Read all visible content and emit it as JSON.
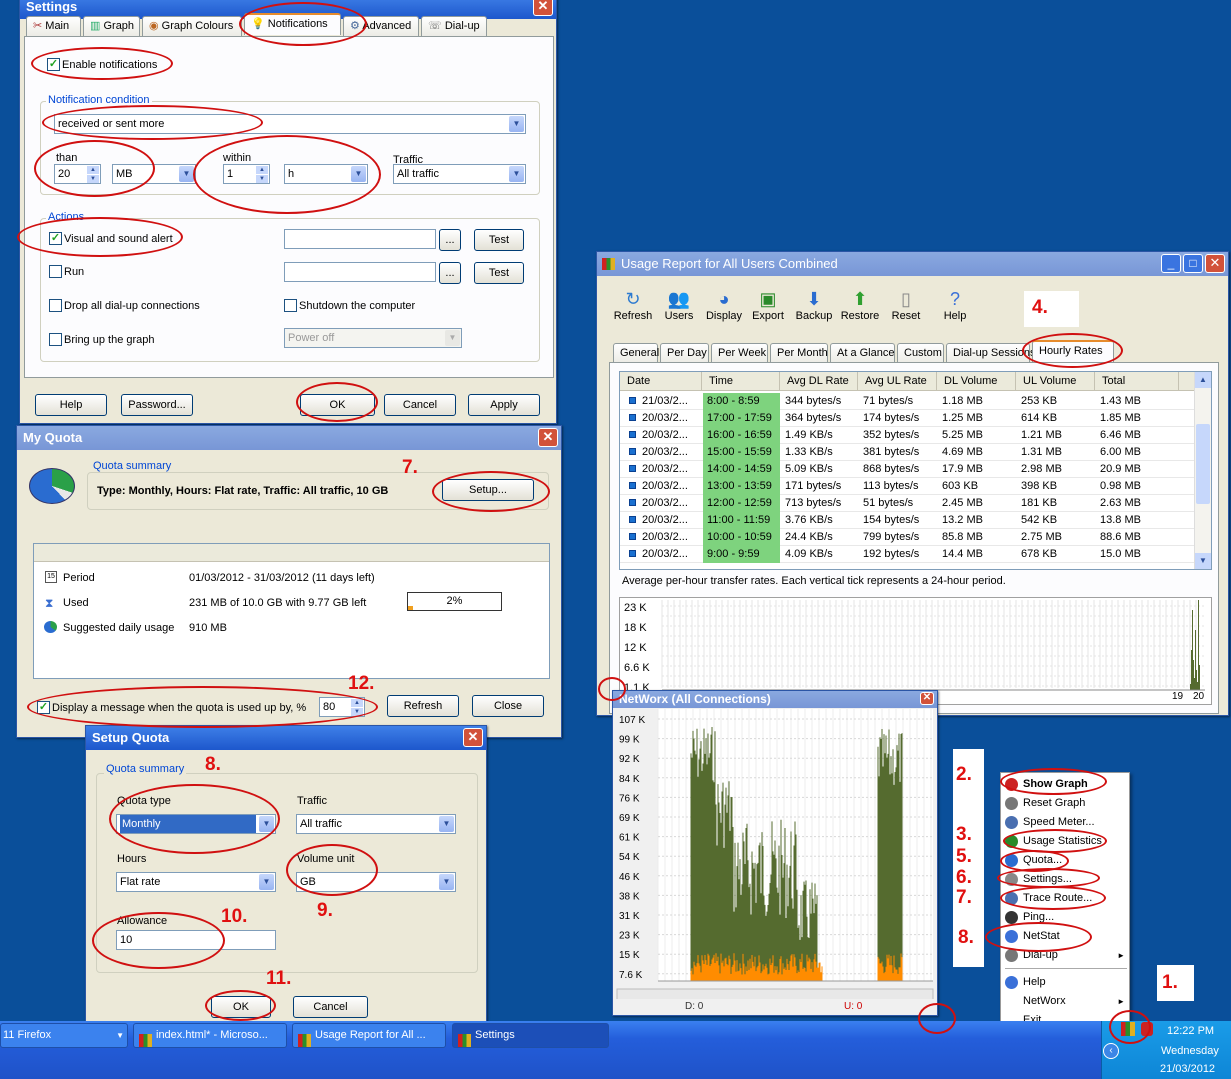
{
  "settings": {
    "title": "Settings",
    "tabs": [
      "Main",
      "Graph",
      "Graph Colours",
      "Notifications",
      "Advanced",
      "Dial-up"
    ],
    "enable_notifications": "Enable notifications",
    "condition_group": "Notification condition",
    "condition_value": "received or sent more",
    "than_label": "than",
    "than_value": "20",
    "than_unit": "MB",
    "within_label": "within",
    "within_value": "1",
    "within_unit": "h",
    "traffic_label": "Traffic",
    "traffic_value": "All traffic",
    "actions_group": "Actions",
    "visual_alert": "Visual and sound alert",
    "run": "Run",
    "drop_dialup": "Drop all dial-up connections",
    "shutdown": "Shutdown the computer",
    "bring_graph": "Bring up the graph",
    "power_value": "Power off",
    "browse": "...",
    "test": "Test",
    "help": "Help",
    "password": "Password...",
    "ok": "OK",
    "cancel": "Cancel",
    "apply": "Apply"
  },
  "quota": {
    "title": "My Quota",
    "summary_group": "Quota summary",
    "summary_text": "Type: Monthly, Hours: Flat rate, Traffic: All traffic, 10 GB",
    "setup": "Setup...",
    "rows": [
      {
        "label": "Period",
        "value": "01/03/2012 - 31/03/2012 (11 days left)"
      },
      {
        "label": "Used",
        "value": "231 MB of 10.0 GB with 9.77 GB left"
      },
      {
        "label": "Suggested daily usage",
        "value": "910 MB"
      }
    ],
    "progress_text": "2%",
    "progress_fraction": 0.02,
    "display_msg": "Display a message when the quota is used up by, %",
    "display_value": "80",
    "refresh": "Refresh",
    "close": "Close"
  },
  "setup": {
    "title": "Setup Quota",
    "summary_group": "Quota summary",
    "type_label": "Quota type",
    "type_value": "Monthly",
    "traffic_label": "Traffic",
    "traffic_value": "All traffic",
    "hours_label": "Hours",
    "hours_value": "Flat rate",
    "unit_label": "Volume unit",
    "unit_value": "GB",
    "allowance_label": "Allowance",
    "allowance_value": "10",
    "ok": "OK",
    "cancel": "Cancel"
  },
  "usage": {
    "title": "Usage Report for All Users Combined",
    "toolbar": [
      "Refresh",
      "Users",
      "Display",
      "Export",
      "Backup",
      "Restore",
      "Reset",
      "Help"
    ],
    "tabs": [
      "General",
      "Per Day",
      "Per Week",
      "Per Month",
      "At a Glance",
      "Custom",
      "Dial-up Sessions",
      "Hourly Rates"
    ],
    "columns": [
      "Date",
      "Time",
      "Avg DL Rate",
      "Avg UL Rate",
      "DL Volume",
      "UL Volume",
      "Total"
    ],
    "rows": [
      [
        "21/03/2...",
        "8:00 - 8:59",
        "344 bytes/s",
        "71 bytes/s",
        "1.18 MB",
        "253 KB",
        "1.43 MB"
      ],
      [
        "20/03/2...",
        "17:00 - 17:59",
        "364 bytes/s",
        "174 bytes/s",
        "1.25 MB",
        "614 KB",
        "1.85 MB"
      ],
      [
        "20/03/2...",
        "16:00 - 16:59",
        "1.49 KB/s",
        "352 bytes/s",
        "5.25 MB",
        "1.21 MB",
        "6.46 MB"
      ],
      [
        "20/03/2...",
        "15:00 - 15:59",
        "1.33 KB/s",
        "381 bytes/s",
        "4.69 MB",
        "1.31 MB",
        "6.00 MB"
      ],
      [
        "20/03/2...",
        "14:00 - 14:59",
        "5.09 KB/s",
        "868 bytes/s",
        "17.9 MB",
        "2.98 MB",
        "20.9 MB"
      ],
      [
        "20/03/2...",
        "13:00 - 13:59",
        "171 bytes/s",
        "113 bytes/s",
        "603 KB",
        "398 KB",
        "0.98 MB"
      ],
      [
        "20/03/2...",
        "12:00 - 12:59",
        "713 bytes/s",
        "51 bytes/s",
        "2.45 MB",
        "181 KB",
        "2.63 MB"
      ],
      [
        "20/03/2...",
        "11:00 - 11:59",
        "3.76 KB/s",
        "154 bytes/s",
        "13.2 MB",
        "542 KB",
        "13.8 MB"
      ],
      [
        "20/03/2...",
        "10:00 - 10:59",
        "24.4 KB/s",
        "799 bytes/s",
        "85.8 MB",
        "2.75 MB",
        "88.6 MB"
      ],
      [
        "20/03/2...",
        "9:00 - 9:59",
        "4.09 KB/s",
        "192 bytes/s",
        "14.4 MB",
        "678 KB",
        "15.0 MB"
      ]
    ],
    "caption": "Average per-hour transfer rates. Each vertical tick represents a 24-hour period.",
    "chart_y": [
      "23 K",
      "18 K",
      "12 K",
      "6.6 K",
      "1.1 K"
    ],
    "chart_x": [
      "19",
      "20"
    ]
  },
  "networx": {
    "title": "NetWorx (All Connections)",
    "y_ticks": [
      "107 K",
      "99 K",
      "92 K",
      "84 K",
      "76 K",
      "69 K",
      "61 K",
      "54 K",
      "46 K",
      "38 K",
      "31 K",
      "23 K",
      "15 K",
      "7.6 K"
    ],
    "download": "D: 0",
    "upload": "U: 0"
  },
  "menu": {
    "items": [
      "Show Graph",
      "Reset Graph",
      "Speed Meter...",
      "Usage Statistics",
      "Quota...",
      "Settings...",
      "Trace Route...",
      "Ping...",
      "NetStat",
      "Dial-up",
      "Help",
      "NetWorx",
      "Exit"
    ]
  },
  "taskbar": {
    "items": [
      "11 Firefox",
      "index.html* - Microso...",
      "Usage Report for All ...",
      "Settings"
    ],
    "time": "12:22 PM",
    "day": "Wednesday",
    "date": "21/03/2012"
  },
  "steps": [
    "1.",
    "2.",
    "3.",
    "4.",
    "5.",
    "6.",
    "7.",
    "7.",
    "8.",
    "8.",
    "9.",
    "10.",
    "11.",
    "12."
  ],
  "colors": {
    "accent_red": "#d01010",
    "graph_green": "#556b2f",
    "graph_orange": "#ff8c00",
    "row_green": "#7ed37e"
  }
}
